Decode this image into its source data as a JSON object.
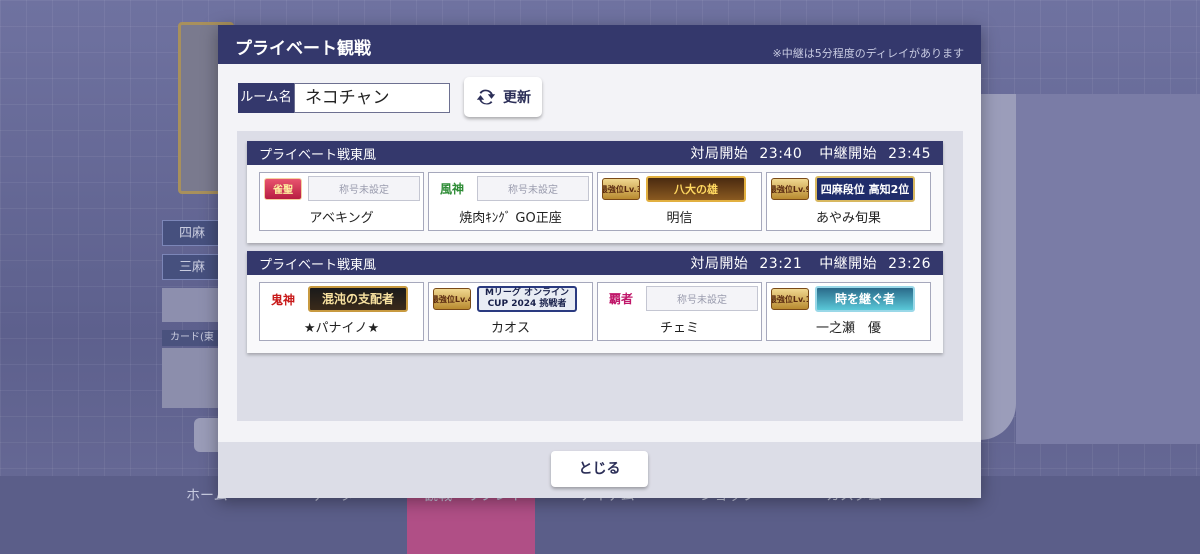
{
  "nav": {
    "items": [
      "ホーム",
      "データ",
      "観戦・リプレイ",
      "アイテム",
      "ショップ",
      "カスタム"
    ]
  },
  "background": {
    "tag_yonma": "四麻",
    "tag_sanma": "三麻",
    "card_label": "カード(東"
  },
  "modal": {
    "title": "プライベート観戦",
    "note": "※中継は5分程度のディレイがあります",
    "room_label": "ルーム名",
    "room_name": "ネコチャン",
    "refresh_label": "更新",
    "close_label": "とじる"
  },
  "rooms": [
    {
      "name": "プライベート戦東風",
      "start_label": "対局開始",
      "start_time": "23:40",
      "relay_label": "中継開始",
      "relay_time": "23:45",
      "players": [
        {
          "rank": "雀聖",
          "title": "称号未設定",
          "name": "アベキング"
        },
        {
          "rank": "風神",
          "title": "称号未設定",
          "name": "焼肉ｷﾝｸﾞ GO正座"
        },
        {
          "rank": "最強位Lv.3",
          "title": "八大の雄",
          "name": "明信"
        },
        {
          "rank": "最強位Lv.9",
          "title": "四麻段位 高知2位",
          "name": "あやみ旬果"
        }
      ]
    },
    {
      "name": "プライベート戦東風",
      "start_label": "対局開始",
      "start_time": "23:21",
      "relay_label": "中継開始",
      "relay_time": "23:26",
      "players": [
        {
          "rank": "鬼神",
          "title": "混沌の支配者",
          "name": "★パナイノ★"
        },
        {
          "rank": "最強位Lv.4",
          "title": "Mリーグ オンラインCUP 2024 挑戦者",
          "name": "カオス"
        },
        {
          "rank": "覇者",
          "title": "称号未設定",
          "name": "チェミ"
        },
        {
          "rank": "最強位Lv.1",
          "title": "時を継ぐ者",
          "name": "一之瀬　優"
        }
      ]
    }
  ],
  "colors": {
    "header_navy": "#34386c",
    "panel_bg": "#f3f3f7",
    "list_bg": "#dcdde7",
    "nav_active": "#b04f86"
  }
}
